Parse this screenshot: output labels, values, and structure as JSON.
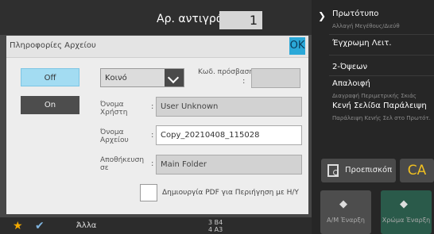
{
  "copies": {
    "label": "Αρ. αντιγράφων",
    "value": "1"
  },
  "right_panel": {
    "items": [
      {
        "label": "Πρωτότυπο",
        "sub": "Αλλαγή Μεγέθους/Διεύθ"
      },
      {
        "label": "Έγχρωμη Λειτ.",
        "sub": ""
      },
      {
        "label": "2-Όψεων",
        "sub": ""
      },
      {
        "label": "Απαλοιφή",
        "sub": "Διαγραφή Περιμετρικής Σκιάς"
      },
      {
        "label": "Κενή Σελίδα Παράλειψη",
        "sub": "Παράλειψη Κενής Σελ στο Πρωτότ."
      }
    ],
    "preview_label": "Προεπισκόπ",
    "ca_label": "CA",
    "start_bw": "Α/Μ Έναρξη",
    "start_color": "Χρώμα Έναρξη"
  },
  "bottom_bar": {
    "other_label": "Άλλα",
    "paper_rows": [
      "3   B4",
      "4   A3"
    ]
  },
  "dialog": {
    "title": "Πληροφορίες Αρχείου",
    "ok_label": "OK",
    "off_label": "Off",
    "on_label": "On",
    "property_select": "Κοινό",
    "password_label": "Κωδ. πρόσβασης",
    "password_value": "",
    "user_label": "Όνομα Χρήστη",
    "user_value": "User Unknown",
    "file_label": "Όνομα Αρχείου",
    "file_value": "Copy_20210408_115028",
    "store_label": "Αποθήκευση σε",
    "store_value": "Main Folder",
    "pdf_checkbox_label": "Δημιουργία PDF για Περιήγηση με Η/Υ",
    "pdf_checked": false
  }
}
